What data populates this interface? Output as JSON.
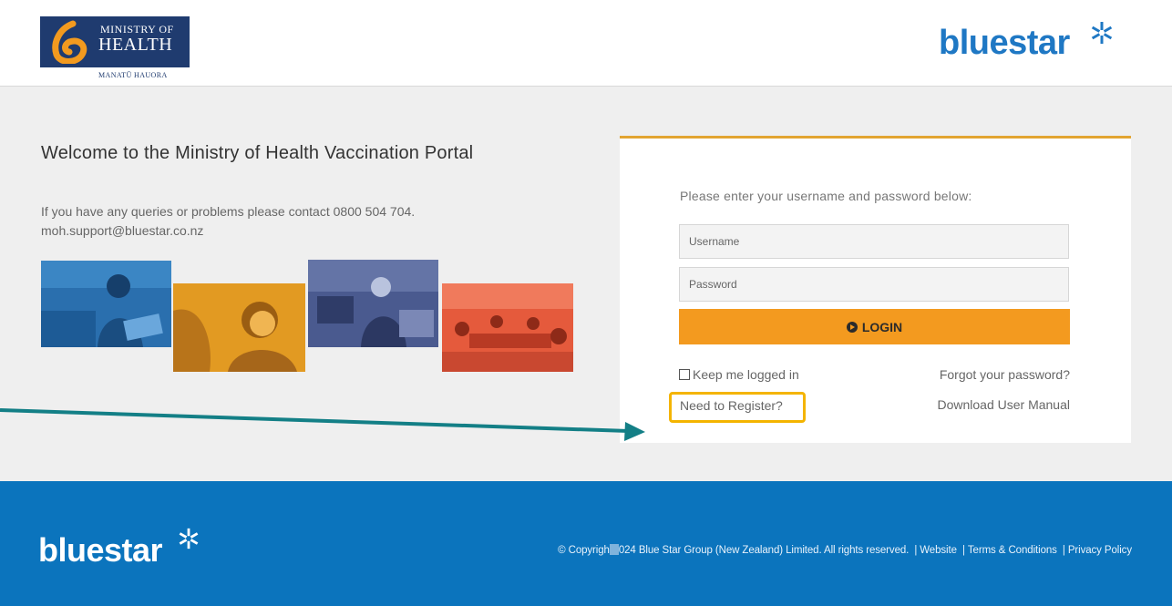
{
  "header": {
    "moh_logo": {
      "line1": "MINISTRY OF",
      "line2": "HEALTH",
      "subtitle": "MANATŪ HAUORA",
      "color": "#1f3b6f"
    },
    "bluestar_logo": {
      "text": "bluestar",
      "color": "#1f78c4",
      "icon": "star-cluster-icon"
    }
  },
  "intro": {
    "title": "Welcome to the Ministry of Health Vaccination Portal",
    "contact_line1": "If you have any queries or problems please contact 0800 504 704.",
    "contact_line2": "moh.support@bluestar.co.nz"
  },
  "photos": [
    {
      "name": "photo-woman-reading",
      "tint": "#2a6fae"
    },
    {
      "name": "photo-smiling-woman",
      "tint": "#d88d1e"
    },
    {
      "name": "photo-warehouse-worker",
      "tint": "#3f4f83"
    },
    {
      "name": "photo-meeting-room",
      "tint": "#e3553a"
    }
  ],
  "login": {
    "prompt": "Please enter your username and password below:",
    "username_placeholder": "Username",
    "password_placeholder": "Password",
    "login_label": "LOGIN",
    "login_icon": "arrow-circle-right-icon",
    "keep_logged_in": "Keep me logged in",
    "forgot_password": "Forgot your password?",
    "register": "Need to Register?",
    "download_manual": "Download User Manual",
    "accent_color": "#e2a431",
    "button_color": "#f39a1f",
    "highlight_color": "#f4b400"
  },
  "annotation": {
    "arrow_color": "#137f86"
  },
  "footer": {
    "logo_text": "bluestar",
    "copyright": "© Copyrigh",
    "copyright_rest": "024 Blue Star Group (New Zealand) Limited. All rights reserved.",
    "links": [
      "Website",
      "Terms & Conditions",
      "Privacy Policy"
    ],
    "separator": "|",
    "background": "#0b74bd"
  }
}
